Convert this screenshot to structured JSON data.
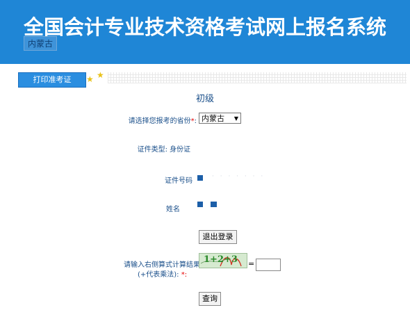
{
  "header": {
    "title": "全国会计专业技术资格考试网上报名系统",
    "province_tag": "内蒙古"
  },
  "nav": {
    "print_tab": "打印准考证"
  },
  "form": {
    "level": "初级",
    "province": {
      "label": "请选择您报考的省份",
      "required_mark": "*",
      "colon": ":",
      "selected": "内蒙古"
    },
    "id_type": {
      "label": "证件类型:",
      "value": "身份证"
    },
    "id_number": {
      "label": "证件号码"
    },
    "name": {
      "label": "姓名"
    },
    "logout_button": "退出登录",
    "captcha": {
      "label_line1": "请输入右侧算式计算结果",
      "label_line2": "(+代表乘法):",
      "required_mark": "*:",
      "image_text": "1+2+3",
      "equals": "="
    },
    "query_button": "查询"
  },
  "colors": {
    "header_bg": "#1f86d6",
    "tab_bg": "#2b8ee0",
    "label_text": "#1a4f8a",
    "required": "#e60000",
    "captcha_bg": "#d6ead0"
  }
}
